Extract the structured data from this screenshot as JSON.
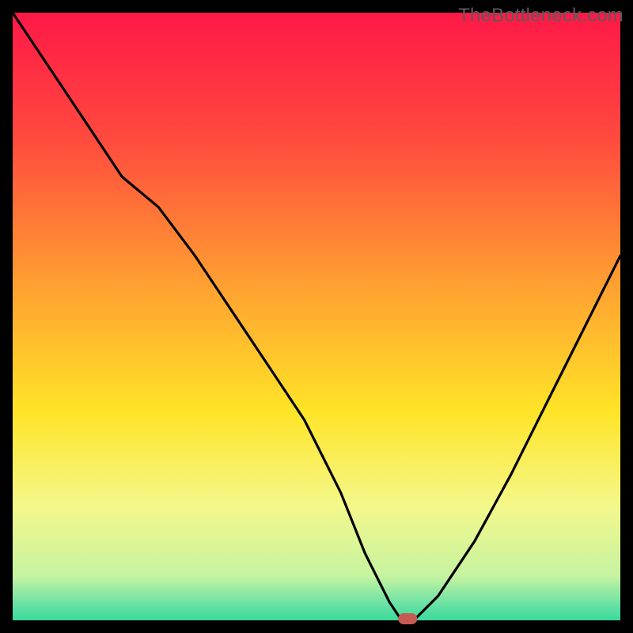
{
  "watermark": "TheBottleneck.com",
  "chart_data": {
    "type": "line",
    "title": "",
    "xlabel": "",
    "ylabel": "",
    "xlim": [
      0,
      100
    ],
    "ylim": [
      0,
      100
    ],
    "notes": "Black curve shows bottleneck percentage over an implied x-axis; minimum (≈0%) occurs where the small red pill marker sits. Background is a vertical red→yellow→green gradient. Values are estimated from pixel positions against the 0–100 y range.",
    "series": [
      {
        "name": "bottleneck-curve",
        "x": [
          0,
          6,
          12,
          18,
          24,
          30,
          36,
          42,
          48,
          54,
          58,
          62,
          64,
          66,
          70,
          76,
          82,
          88,
          94,
          100
        ],
        "y": [
          100,
          91,
          82,
          73,
          68,
          60,
          51,
          42,
          33,
          21,
          11,
          3,
          0,
          0,
          4,
          13,
          24,
          36,
          48,
          60
        ]
      }
    ],
    "marker": {
      "x": 65,
      "y": 0,
      "label": "optimal-point"
    },
    "gradient_stops": [
      {
        "pct": 0,
        "color": "#ff1348"
      },
      {
        "pct": 22,
        "color": "#ff4a3e"
      },
      {
        "pct": 45,
        "color": "#ffa031"
      },
      {
        "pct": 65,
        "color": "#ffe427"
      },
      {
        "pct": 80,
        "color": "#f4f88b"
      },
      {
        "pct": 91,
        "color": "#c6f3a1"
      },
      {
        "pct": 96,
        "color": "#5fe0a4"
      },
      {
        "pct": 100,
        "color": "#17d391"
      }
    ],
    "frame_color": "#000000",
    "frame_thickness_px": 16
  }
}
